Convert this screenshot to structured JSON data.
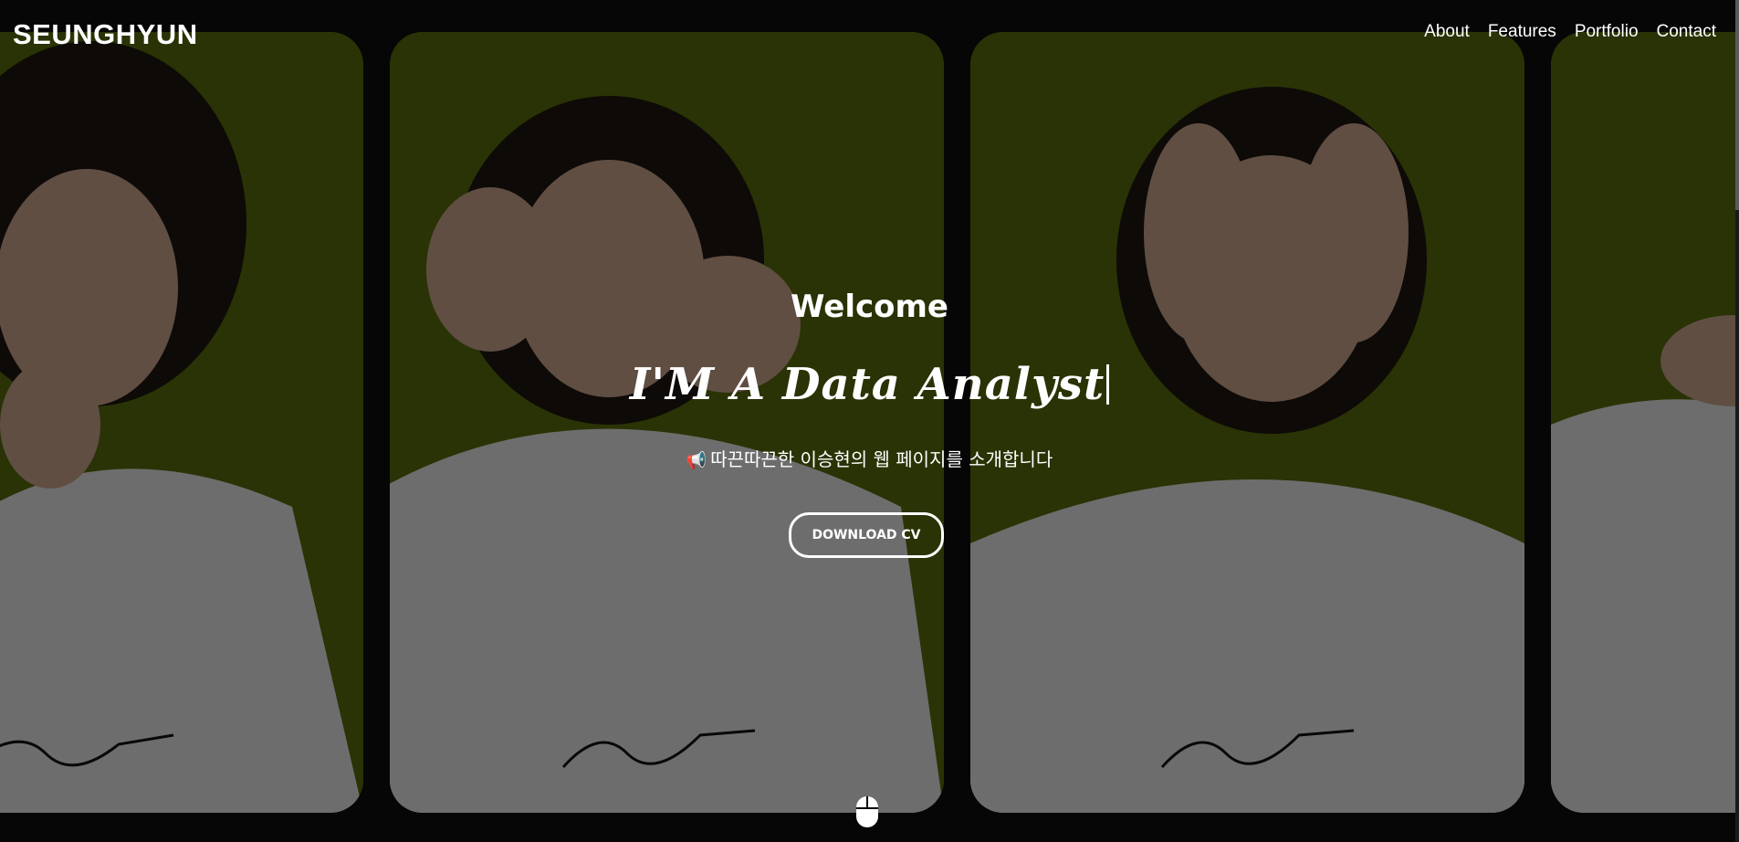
{
  "header": {
    "logo": "SEUNGHYUN",
    "nav": [
      {
        "label": "About"
      },
      {
        "label": "Features"
      },
      {
        "label": "Portfolio"
      },
      {
        "label": "Contact"
      }
    ]
  },
  "hero": {
    "welcome": "Welcome",
    "headline": "I'M A Data Analyst",
    "megaphone_icon": "📢",
    "tagline": "따끈따끈한 이승현의 웹 페이지를 소개합니다",
    "download_button": "DOWNLOAD CV"
  },
  "colors": {
    "panel_bg": "#576b0c",
    "page_bg": "#060606",
    "text": "#ffffff"
  },
  "icons": {
    "scroll_indicator": "mouse-icon"
  }
}
